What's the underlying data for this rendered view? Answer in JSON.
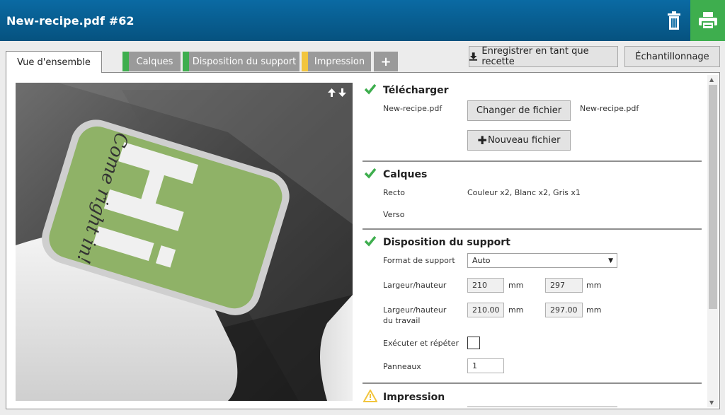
{
  "header": {
    "title": "New-recipe.pdf #62"
  },
  "tabs": [
    {
      "label": "Vue d'ensemble"
    },
    {
      "label": "Calques",
      "status_color": "#3eae4e"
    },
    {
      "label": "Disposition du support",
      "status_color": "#3eae4e"
    },
    {
      "label": "Impression",
      "status_color": "#f2c53d"
    },
    {
      "label": "+"
    }
  ],
  "toolbar": {
    "save_recipe": "Enregistrer en tant que recette",
    "sampling": "Échantillonnage"
  },
  "sections": {
    "upload": {
      "title": "Télécharger",
      "filename": "New-recipe.pdf",
      "change_button": "Changer de fichier",
      "current_file": "New-recipe.pdf",
      "new_button": "Nouveau fichier"
    },
    "layers": {
      "title": "Calques",
      "front_label": "Recto",
      "front_value": "Couleur x2, Blanc x2, Gris x1",
      "back_label": "Verso"
    },
    "media": {
      "title": "Disposition du support",
      "format_label": "Format de support",
      "format_value": "Auto",
      "wh_label": "Largeur/hauteur",
      "width": "210",
      "height": "297",
      "unit": "mm",
      "work_label_1": "Largeur/hauteur",
      "work_label_2": "du travail",
      "work_width": "210.00",
      "work_height": "297.00",
      "step_repeat_label": "Exécuter et répéter",
      "panels_label": "Panneaux",
      "panels_value": "1"
    },
    "print": {
      "title": "Impression"
    }
  },
  "preview": {
    "card_text": "Hi",
    "card_script": "Come right in!",
    "card_color": "#8fb267"
  },
  "colors": {
    "header": "#06527f",
    "accent_green": "#3eae4e",
    "warning": "#f2c53d"
  }
}
